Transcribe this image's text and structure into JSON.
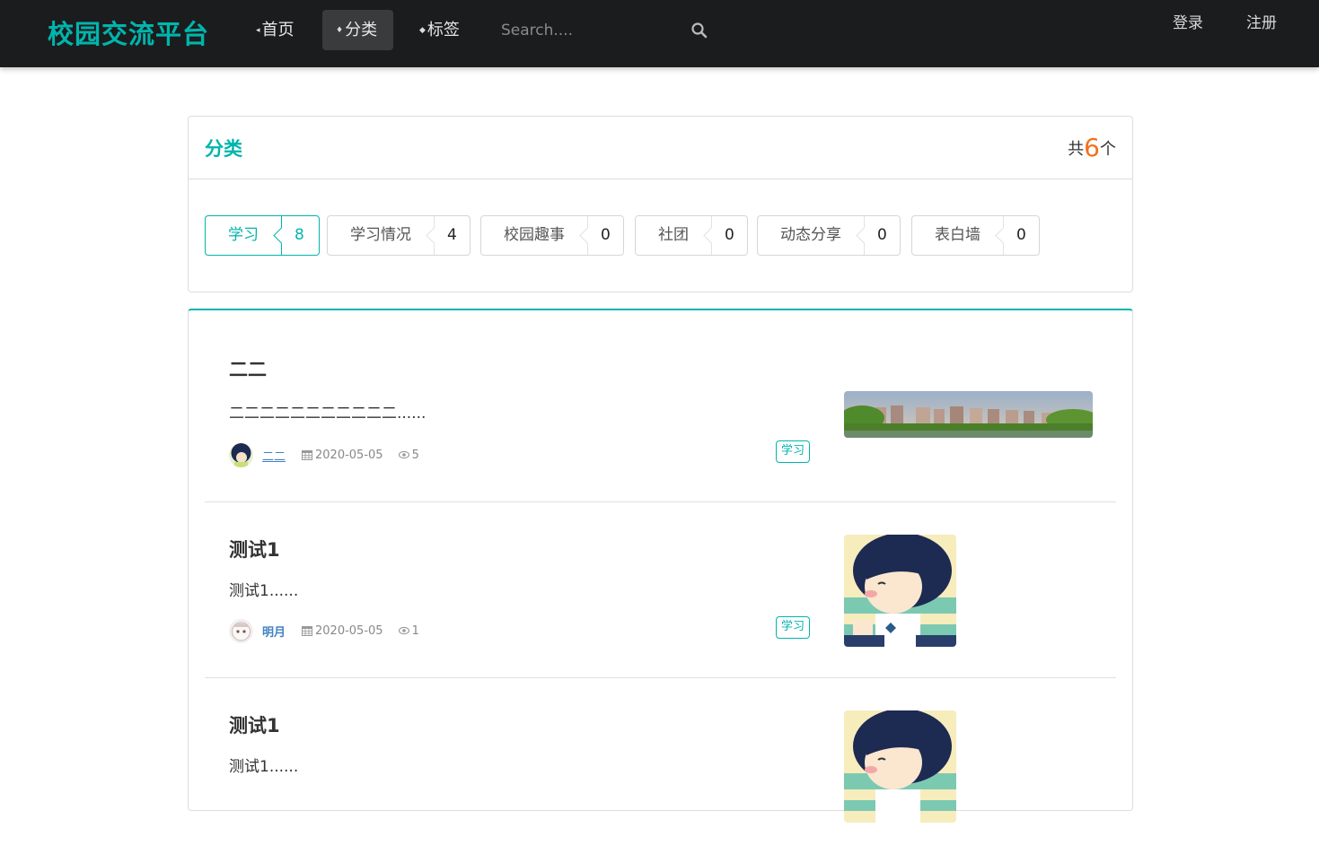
{
  "nav": {
    "brand": "校园交流平台",
    "home": "首页",
    "category": "分类",
    "tags": "标签",
    "search_placeholder": "Search....",
    "login": "登录",
    "register": "注册"
  },
  "category_panel": {
    "title": "分类",
    "count_prefix": "共",
    "count": "6",
    "count_suffix": "个",
    "items": [
      {
        "name": "学习",
        "count": "8",
        "active": true
      },
      {
        "name": "学习情况",
        "count": "4",
        "active": false
      },
      {
        "name": "校园趣事",
        "count": "0",
        "active": false
      },
      {
        "name": "社团",
        "count": "0",
        "active": false
      },
      {
        "name": "动态分享",
        "count": "0",
        "active": false
      },
      {
        "name": "表白墙",
        "count": "0",
        "active": false
      }
    ]
  },
  "posts": [
    {
      "title": "二二",
      "excerpt": "二二二二二二二二二二二......",
      "author": "二二",
      "date": "2020-05-05",
      "views": "5",
      "tag": "学习",
      "image": "campus-photo"
    },
    {
      "title": "测试1",
      "excerpt": "测试1......",
      "author": "明月",
      "date": "2020-05-05",
      "views": "1",
      "tag": "学习",
      "image": "cartoon-boy"
    },
    {
      "title": "测试1",
      "excerpt": "测试1......",
      "author": "",
      "date": "",
      "views": "",
      "tag": "",
      "image": "cartoon-boy"
    }
  ],
  "colors": {
    "accent": "#00b5ad",
    "navbar": "#1b1c1d",
    "count_highlight": "#f2711c",
    "link": "#4183c4"
  }
}
